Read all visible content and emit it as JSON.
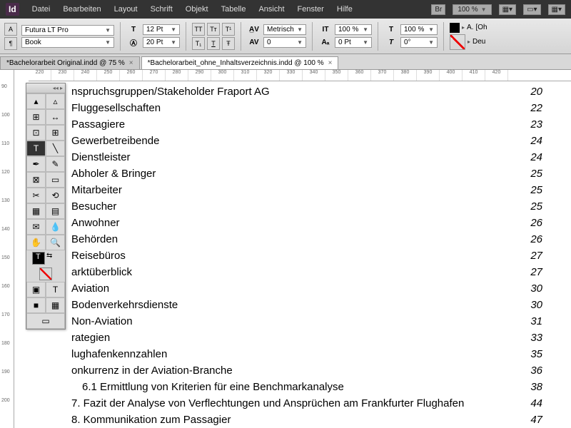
{
  "menu": [
    "Datei",
    "Bearbeiten",
    "Layout",
    "Schrift",
    "Objekt",
    "Tabelle",
    "Ansicht",
    "Fenster",
    "Hilfe"
  ],
  "topbar": {
    "br": "Br",
    "zoom": "100 %"
  },
  "control": {
    "font": "Futura LT Pro",
    "style": "Book",
    "size": "12 Pt",
    "leading": "20 Pt",
    "kerning": "Metrisch",
    "tracking": "0",
    "vscale": "100 %",
    "hscale": "100 %",
    "baseline": "0 Pt",
    "skew": "0°",
    "lang": "Deu",
    "oh": "[Oh"
  },
  "tabs": [
    {
      "label": "*Bachelorarbeit Original.indd @ 75 %",
      "active": false
    },
    {
      "label": "*Bachelorarbeit_ohne_Inhaltsverzeichnis.indd @ 100 %",
      "active": true
    }
  ],
  "ruler_top": [
    "220",
    "230",
    "240",
    "250",
    "260",
    "270",
    "280",
    "290",
    "300",
    "310",
    "320",
    "330",
    "340",
    "350",
    "360",
    "370",
    "380",
    "390",
    "400",
    "410",
    "420"
  ],
  "ruler_left": [
    "90",
    "100",
    "110",
    "120",
    "130",
    "140",
    "150",
    "160",
    "170",
    "180",
    "190",
    "200"
  ],
  "toc": [
    {
      "t": "nspruchsgruppen/Stakeholder Fraport AG",
      "p": "20",
      "indent": false
    },
    {
      "t": "Fluggesellschaften",
      "p": "22",
      "indent": false
    },
    {
      "t": "Passagiere",
      "p": "23",
      "indent": false
    },
    {
      "t": "Gewerbetreibende",
      "p": "24",
      "indent": false
    },
    {
      "t": "Dienstleister",
      "p": "24",
      "indent": false
    },
    {
      "t": "Abholer & Bringer",
      "p": "25",
      "indent": false
    },
    {
      "t": "Mitarbeiter",
      "p": "25",
      "indent": false
    },
    {
      "t": "Besucher",
      "p": "25",
      "indent": false
    },
    {
      "t": "Anwohner",
      "p": "26",
      "indent": false
    },
    {
      "t": "Behörden",
      "p": "26",
      "indent": false
    },
    {
      "t": "  Reisebüros",
      "p": "27",
      "indent": false
    },
    {
      "t": "arktüberblick",
      "p": "27",
      "indent": false
    },
    {
      "t": "Aviation",
      "p": "30",
      "indent": false
    },
    {
      "t": "Bodenverkehrsdienste",
      "p": "30",
      "indent": false
    },
    {
      "t": "Non-Aviation",
      "p": "31",
      "indent": false
    },
    {
      "t": "rategien",
      "p": "33",
      "indent": false
    },
    {
      "t": "lughafenkennzahlen",
      "p": "35",
      "indent": false
    },
    {
      "t": "onkurrenz in der Aviation-Branche",
      "p": "36",
      "indent": false
    },
    {
      "t": "6.1 Ermittlung von Kriterien für eine Benchmarkanalyse",
      "p": "38",
      "indent": true
    },
    {
      "t": "7. Fazit der Analyse von Verflechtungen und Ansprüchen am Frankfurter Flughafen",
      "p": "44",
      "indent": false
    },
    {
      "t": "8. Kommunikation zum Passagier",
      "p": "47",
      "indent": false
    }
  ]
}
